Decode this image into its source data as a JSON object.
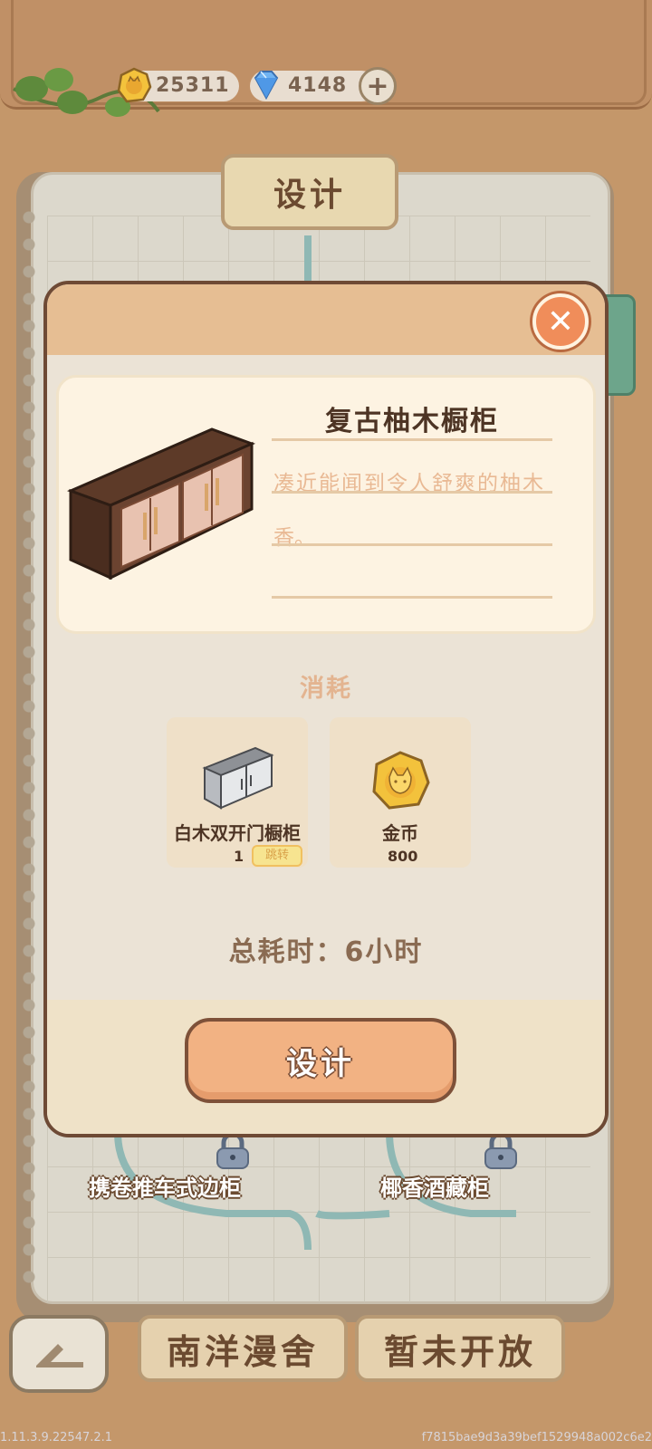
{
  "currency": {
    "coins": "25311",
    "gems": "4148",
    "add_label": "+"
  },
  "board": {
    "title": "设计"
  },
  "background_nodes": [
    {
      "label": "携卷推车式边柜"
    },
    {
      "label": "椰香酒藏柜"
    }
  ],
  "bottom_tabs": [
    {
      "label": "南洋漫舍"
    },
    {
      "label": "暂未开放"
    }
  ],
  "modal": {
    "close_label": "✕",
    "item_name": "复古柚木橱柜",
    "description_line1": "凑近能闻到令人舒爽的柚木",
    "description_line2": "香。",
    "cost_title": "消耗",
    "costs": [
      {
        "name": "白木双开门橱柜",
        "amount": "1",
        "jump_label": "跳转",
        "icon": "cabinet-icon"
      },
      {
        "name": "金币",
        "amount": "800",
        "icon": "coin-icon"
      }
    ],
    "total_time": "总耗时：6小时",
    "design_button": "设计"
  },
  "footer": {
    "version": "1.11.3.9.22547.2.1",
    "hash": "f7815bae9d3a39bef1529948a002c6e2"
  },
  "colors": {
    "accent": "#f2b283",
    "close": "#f08d5a",
    "dark_text": "#4d3424",
    "desc_text": "#e9b994"
  }
}
